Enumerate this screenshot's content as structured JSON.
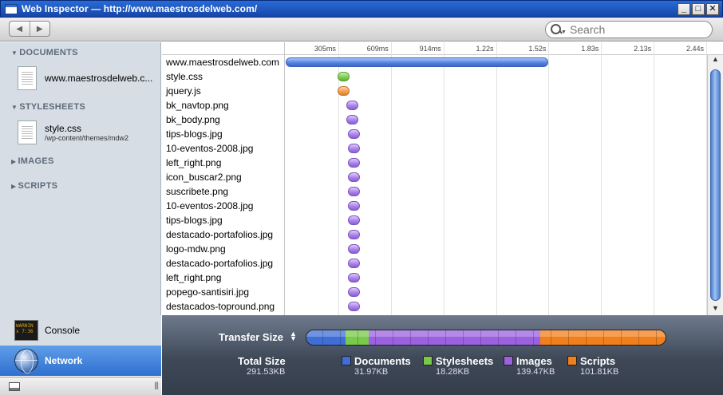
{
  "window": {
    "title": "Web Inspector — http://www.maestrosdelweb.com/",
    "minimize": "_",
    "maximize": "□",
    "close": "✕"
  },
  "toolbar": {
    "back_icon": "◀",
    "forward_icon": "▶",
    "search_placeholder": "Search"
  },
  "sidebar": {
    "documents_header": "DOCUMENTS",
    "documents_item": "www.maestrosdelweb.c...",
    "stylesheets_header": "STYLESHEETS",
    "stylesheet_name": "style.css",
    "stylesheet_path": "/wp-content/themes/mdw2",
    "images_header": "IMAGES",
    "scripts_header": "SCRIPTS",
    "console_label": "Console",
    "console_icon_text": "WARNIN\nx 7:36",
    "network_label": "Network",
    "expanded_marker": "▼",
    "collapsed_marker": "▶"
  },
  "timeline": {
    "ticks": [
      "305ms",
      "609ms",
      "914ms",
      "1.22s",
      "1.52s",
      "1.83s",
      "2.13s",
      "2.44s"
    ],
    "rows": [
      {
        "name": "www.maestrosdelweb.com",
        "type": "document",
        "start": 0,
        "end": 1.525
      },
      {
        "name": "style.css",
        "type": "stylesheet",
        "start": 0.3,
        "end": 0.37
      },
      {
        "name": "jquery.js",
        "type": "script",
        "start": 0.3,
        "end": 0.37
      },
      {
        "name": "bk_navtop.png",
        "type": "image",
        "start": 0.35,
        "end": 0.42
      },
      {
        "name": "bk_body.png",
        "type": "image",
        "start": 0.35,
        "end": 0.42
      },
      {
        "name": "tips-blogs.jpg",
        "type": "image",
        "start": 0.36,
        "end": 0.43
      },
      {
        "name": "10-eventos-2008.jpg",
        "type": "image",
        "start": 0.36,
        "end": 0.43
      },
      {
        "name": "left_right.png",
        "type": "image",
        "start": 0.36,
        "end": 0.43
      },
      {
        "name": "icon_buscar2.png",
        "type": "image",
        "start": 0.36,
        "end": 0.43
      },
      {
        "name": "suscribete.png",
        "type": "image",
        "start": 0.36,
        "end": 0.43
      },
      {
        "name": "10-eventos-2008.jpg",
        "type": "image",
        "start": 0.36,
        "end": 0.43
      },
      {
        "name": "tips-blogs.jpg",
        "type": "image",
        "start": 0.36,
        "end": 0.43
      },
      {
        "name": "destacado-portafolios.jpg",
        "type": "image",
        "start": 0.36,
        "end": 0.43
      },
      {
        "name": "logo-mdw.png",
        "type": "image",
        "start": 0.36,
        "end": 0.43
      },
      {
        "name": "destacado-portafolios.jpg",
        "type": "image",
        "start": 0.36,
        "end": 0.43
      },
      {
        "name": "left_right.png",
        "type": "image",
        "start": 0.36,
        "end": 0.43
      },
      {
        "name": "popego-santisiri.jpg",
        "type": "image",
        "start": 0.36,
        "end": 0.43
      },
      {
        "name": "destacados-topround.png",
        "type": "image",
        "start": 0.36,
        "end": 0.43
      }
    ],
    "scroll_up": "▲",
    "scroll_down": "▼"
  },
  "summary": {
    "title": "Transfer Size",
    "toggle": "▲\n▼",
    "total_label": "Total Size",
    "total_value": "291.53KB",
    "categories": [
      {
        "label": "Documents",
        "value": "31.97KB",
        "kb": 31.97,
        "color": "#3f6fd6"
      },
      {
        "label": "Stylesheets",
        "value": "18.28KB",
        "kb": 18.28,
        "color": "#79c94a"
      },
      {
        "label": "Images",
        "value": "139.47KB",
        "kb": 139.47,
        "color": "#9b62e0"
      },
      {
        "label": "Scripts",
        "value": "101.81KB",
        "kb": 101.81,
        "color": "#f07f1c"
      }
    ]
  }
}
